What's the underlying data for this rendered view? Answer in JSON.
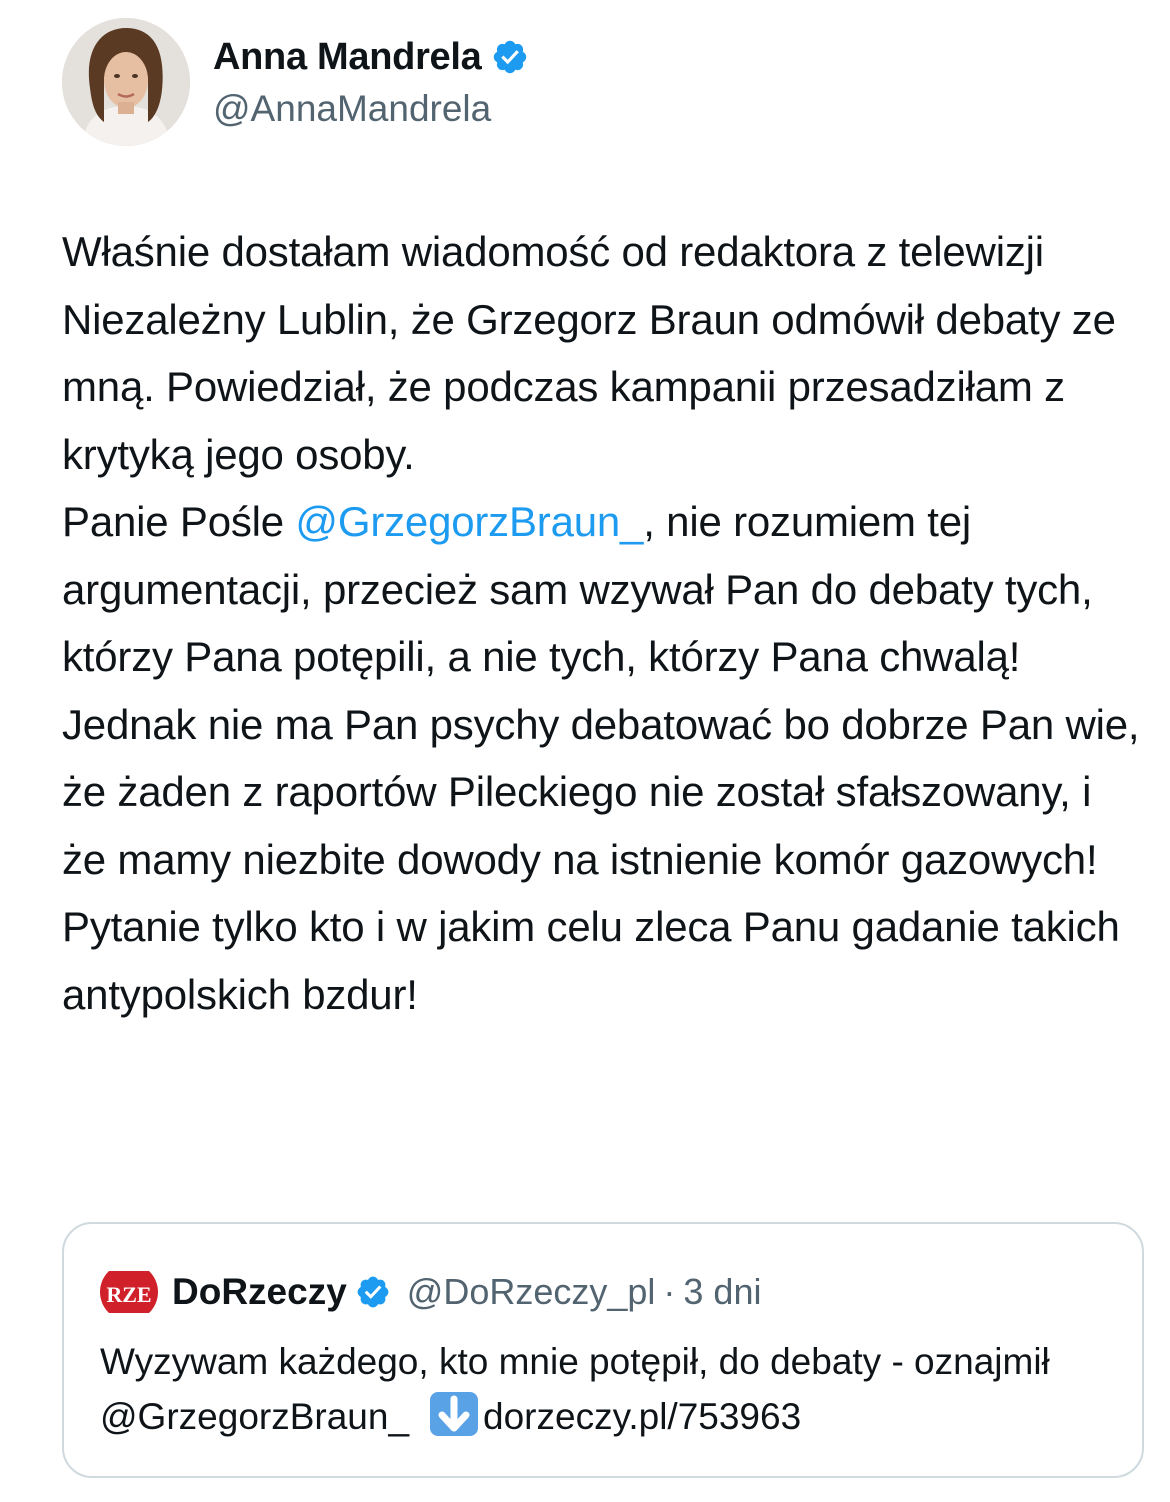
{
  "author": {
    "name": "Anna Mandrela",
    "handle": "@AnnaMandrela",
    "verified": true
  },
  "tweet": {
    "paragraphs": [
      {
        "before": "Właśnie dostałam wiadomość od redaktora z telewizji Niezależny Lublin, że Grzegorz Braun odmówił debaty ze mną. Powiedział, że podczas kampanii przesadziłam z krytyką jego osoby.",
        "mention": "",
        "after": ""
      },
      {
        "before": "Panie Pośle ",
        "mention": "@GrzegorzBraun_",
        "after": ", nie rozumiem tej argumentacji, przecież sam wzywał Pan do debaty tych, którzy Pana potępili, a nie tych, którzy Pana chwalą!"
      },
      {
        "before": "Jednak nie ma Pan psychy debatować bo dobrze Pan wie, że żaden z raportów Pileckiego nie został sfałszowany, i że mamy niezbite dowody na istnienie komór gazowych!",
        "mention": "",
        "after": ""
      },
      {
        "before": "Pytanie tylko kto i w jakim celu zleca Panu gadanie takich antypolskich bzdur!",
        "mention": "",
        "after": ""
      }
    ]
  },
  "quoted_tweet": {
    "logo_text": "RZE",
    "name": "DoRzeczy",
    "handle": "@DoRzeczy_pl",
    "separator": "·",
    "time": "3 dni",
    "text_before": "Wyzywam każdego, kto mnie potępił, do debaty - oznajmił @GrzegorzBraun_",
    "emoji": "down-arrow-emoji",
    "link": "dorzeczy.pl/753963"
  },
  "colors": {
    "text": "#0f1419",
    "secondary": "#536471",
    "link": "#1d9bf0",
    "verified": "#1d9bf0",
    "border": "#cfd9de",
    "dorzeczy_red": "#d0202a"
  }
}
